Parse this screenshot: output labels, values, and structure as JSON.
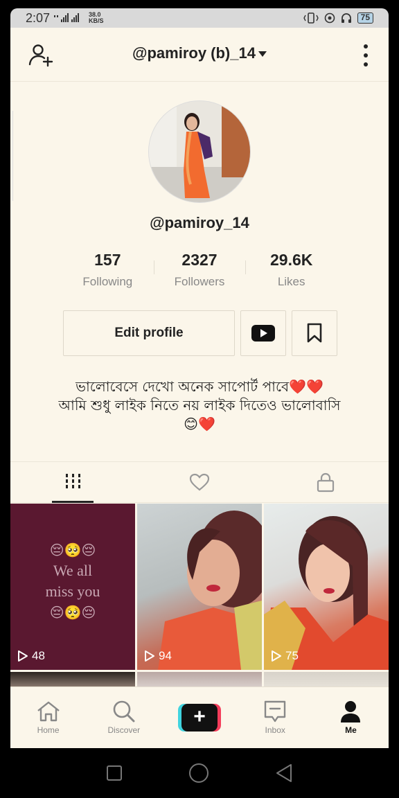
{
  "status_bar": {
    "time": "2:07",
    "net_speed_value": "38.0",
    "net_speed_unit": "KB/S",
    "battery": "75"
  },
  "header": {
    "account_name": "@pamiroy (b)_14"
  },
  "profile": {
    "username": "@pamiroy_14",
    "stats": [
      {
        "value": "157",
        "label": "Following"
      },
      {
        "value": "2327",
        "label": "Followers"
      },
      {
        "value": "29.6K",
        "label": "Likes"
      }
    ],
    "edit_profile_label": "Edit profile",
    "bio_lines": [
      "ভালোবেসে দেখো অনেক সাপোর্ট পাবে❤️❤️",
      "আমি শুধু লাইক নিতে নয় লাইক দিতেও ভালোবাসি",
      "😊❤️"
    ]
  },
  "videos": [
    {
      "views": "48",
      "overlay_lines": [
        "😔🥺😔",
        "We all",
        "miss you",
        "😔🥺😔"
      ]
    },
    {
      "views": "94"
    },
    {
      "views": "75"
    }
  ],
  "bottom_nav": {
    "home": "Home",
    "discover": "Discover",
    "create": "+",
    "inbox": "Inbox",
    "me": "Me"
  },
  "colors": {
    "background": "#fbf6ea",
    "create_left": "#40d4df",
    "create_right": "#f43d5b",
    "thumb1_bg": "#5a1830"
  }
}
